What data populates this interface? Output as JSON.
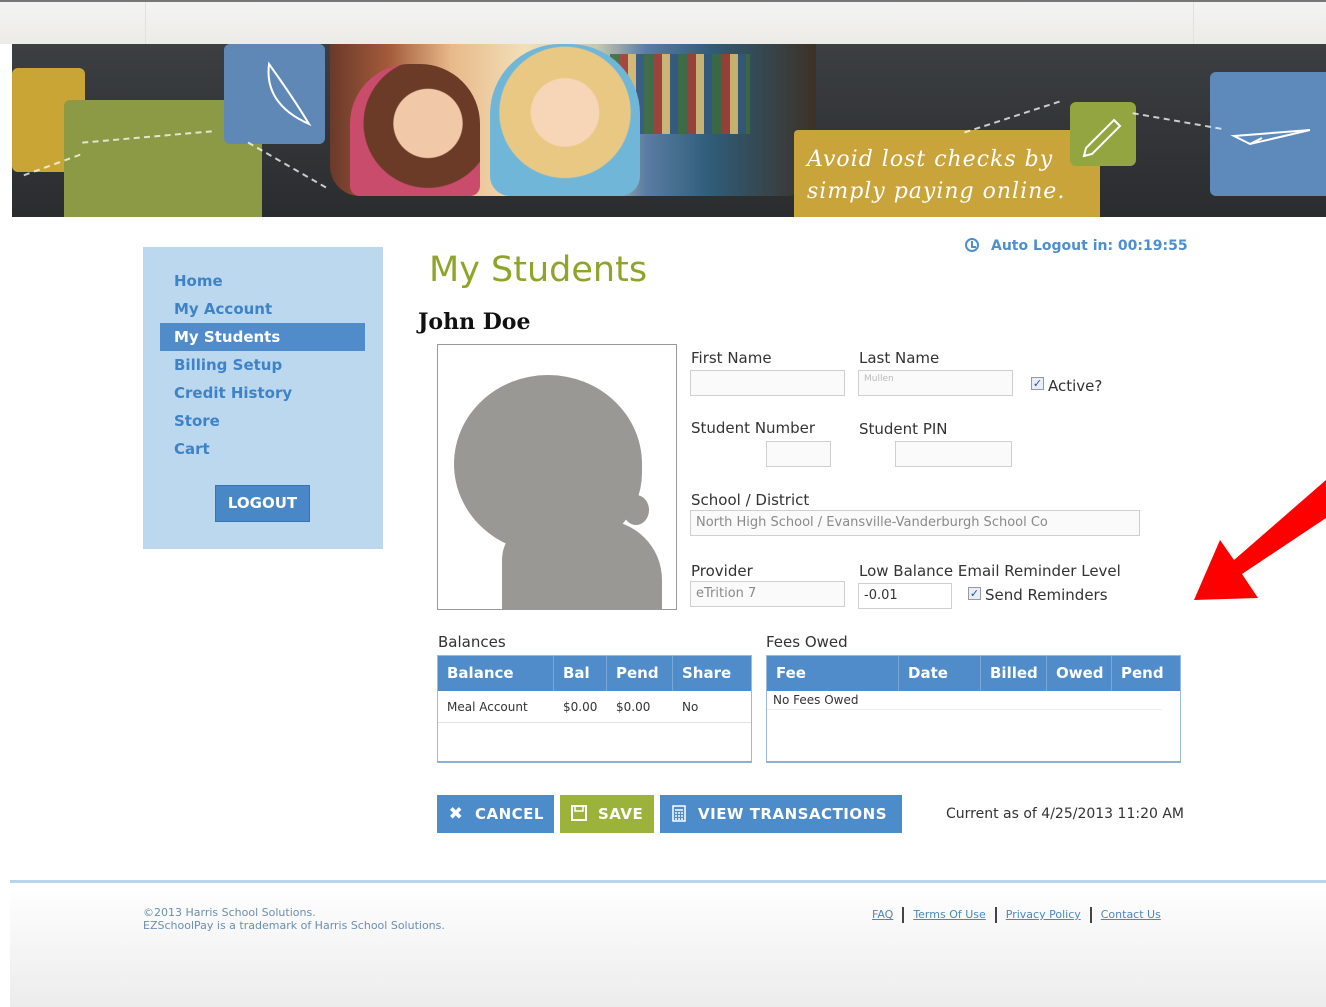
{
  "banner": {
    "tagline_line1": "Avoid lost checks by",
    "tagline_line2": "simply paying online."
  },
  "header": {
    "auto_logout": "Auto Logout in: 00:19:55"
  },
  "sidebar": {
    "items": [
      {
        "label": "Home"
      },
      {
        "label": "My Account"
      },
      {
        "label": "My Students"
      },
      {
        "label": "Billing Setup"
      },
      {
        "label": "Credit History"
      },
      {
        "label": "Store"
      },
      {
        "label": "Cart"
      }
    ],
    "active": "My Students",
    "logout_label": "LOGOUT"
  },
  "main": {
    "title": "My Students",
    "student_name": "John Doe",
    "form": {
      "first_name_label": "First Name",
      "first_name_value": "",
      "last_name_label": "Last Name",
      "last_name_value": "Mullen",
      "active_label": "Active?",
      "active_checked": true,
      "student_number_label": "Student Number",
      "student_number_value": "",
      "student_pin_label": "Student PIN",
      "student_pin_value": "",
      "school_label": "School / District",
      "school_value": "North High School / Evansville-Vanderburgh School Co",
      "provider_label": "Provider",
      "provider_value": "eTrition 7",
      "low_balance_label": "Low Balance Email Reminder Level",
      "low_balance_value": "-0.01",
      "send_reminders_label": "Send Reminders",
      "send_reminders_checked": true
    },
    "balances": {
      "title": "Balances",
      "columns": [
        "Balance Type",
        "Bal",
        "Pend",
        "Share"
      ],
      "rows": [
        [
          "Meal Account",
          "$0.00",
          "$0.00",
          "No"
        ]
      ]
    },
    "fees": {
      "title": "Fees Owed",
      "columns": [
        "Fee",
        "Date",
        "Billed",
        "Owed",
        "Pend"
      ],
      "empty_text": "No Fees Owed"
    },
    "buttons": {
      "cancel": "CANCEL",
      "save": "SAVE",
      "view_transactions": "VIEW TRANSACTIONS"
    },
    "current_as_of": "Current as of 4/25/2013 11:20 AM"
  },
  "footer": {
    "copyright_line1": "©2013 Harris School Solutions.",
    "copyright_line2": "EZSchoolPay is a trademark of Harris School Solutions.",
    "links": [
      "FAQ",
      "Terms Of Use",
      "Privacy Policy",
      "Contact Us"
    ]
  },
  "colors": {
    "accent_blue": "#4f8cc9",
    "title_green": "#8fa52a",
    "save_green": "#9bb33a",
    "annotation_red": "#ff0000"
  }
}
